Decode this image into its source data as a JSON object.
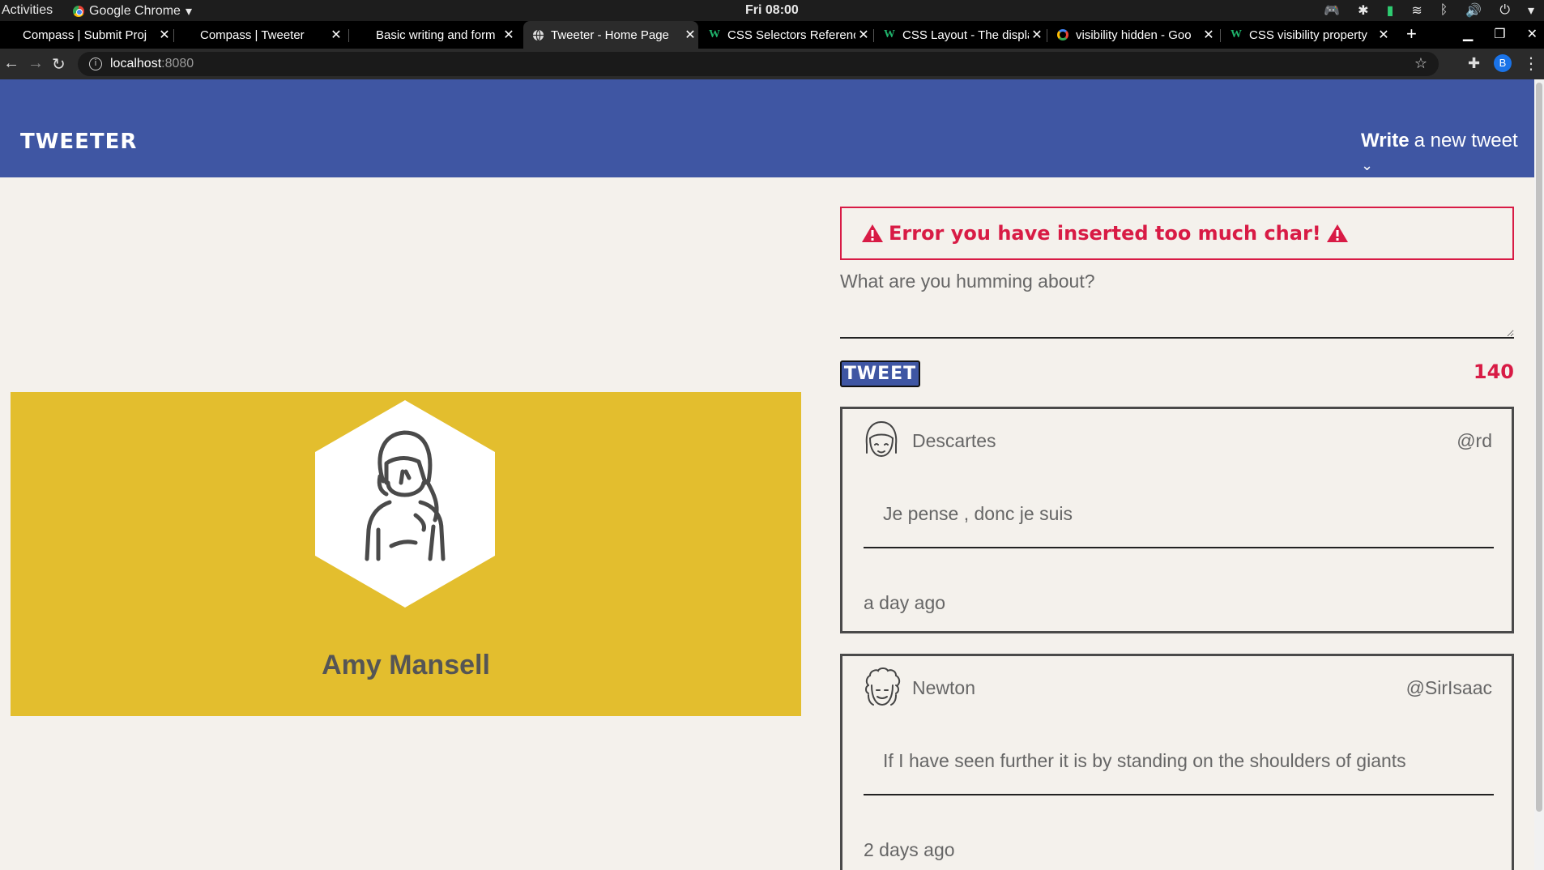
{
  "system_bar": {
    "activities": "Activities",
    "app_name": "Google Chrome",
    "clock": "Fri 08:00"
  },
  "tabs": [
    {
      "title": "Compass | Submit Proj",
      "favicon": "none",
      "active": false
    },
    {
      "title": "Compass | Tweeter",
      "favicon": "none",
      "active": false
    },
    {
      "title": "Basic writing and form",
      "favicon": "none",
      "active": false
    },
    {
      "title": "Tweeter - Home Page",
      "favicon": "globe",
      "active": true
    },
    {
      "title": "CSS Selectors Referenc",
      "favicon": "w3schools",
      "active": false
    },
    {
      "title": "CSS Layout - The displa",
      "favicon": "w3schools",
      "active": false
    },
    {
      "title": "visibility hidden - Goo",
      "favicon": "google",
      "active": false
    },
    {
      "title": "CSS visibility property",
      "favicon": "w3schools",
      "active": false
    }
  ],
  "address_bar": {
    "host": "localhost",
    "port": ":8080",
    "profile_initial": "B"
  },
  "nav": {
    "brand": "TWEETER",
    "compose_bold": "Write",
    "compose_rest": "a new tweet"
  },
  "profile": {
    "name": "Amy Mansell"
  },
  "composer": {
    "error": "Error you have inserted too much char!",
    "prompt": "What are you humming about?",
    "input_value": "",
    "button": "TWEET",
    "counter": "140"
  },
  "tweets": [
    {
      "name": "Descartes",
      "handle": "@rd",
      "text": "Je pense , donc je suis",
      "time": "a day ago",
      "avatar": "girl-avatar-icon"
    },
    {
      "name": "Newton",
      "handle": "@SirIsaac",
      "text": "If I have seen further it is by standing on the shoulders of giants",
      "time": "2 days ago",
      "avatar": "curly-hair-avatar-icon"
    }
  ],
  "colors": {
    "nav_blue": "#3f56a3",
    "profile_yellow": "#e3be2e",
    "error_red": "#d81b45",
    "page_bg": "#f4f1ec"
  }
}
